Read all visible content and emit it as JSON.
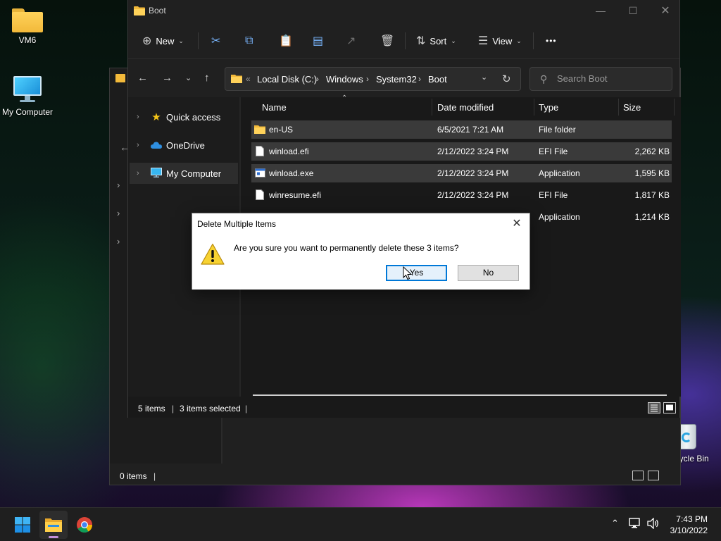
{
  "desktop": {
    "icons": [
      {
        "label": "VM6",
        "icon": "folder-icon"
      },
      {
        "label": "My Computer",
        "icon": "monitor-icon"
      },
      {
        "label": "Recycle Bin",
        "icon": "recycle-bin-icon"
      }
    ]
  },
  "back_window": {
    "status": "0 items"
  },
  "explorer": {
    "title": "Boot",
    "toolbar": {
      "new_label": "New",
      "sort_label": "Sort",
      "view_label": "View",
      "more_label": "•••"
    },
    "address": {
      "overflow": "«",
      "crumbs": [
        "Local Disk (C:)",
        "Windows",
        "System32",
        "Boot"
      ]
    },
    "search": {
      "placeholder": "Search Boot"
    },
    "nav": [
      {
        "label": "Quick access",
        "icon": "star-icon"
      },
      {
        "label": "OneDrive",
        "icon": "cloud-icon"
      },
      {
        "label": "My Computer",
        "icon": "monitor-icon"
      }
    ],
    "columns": [
      "Name",
      "Date modified",
      "Type",
      "Size"
    ],
    "rows": [
      {
        "name": "en-US",
        "date": "6/5/2021 7:21 AM",
        "type": "File folder",
        "size": "",
        "selected": true,
        "icon": "folder-icon"
      },
      {
        "name": "winload.efi",
        "date": "2/12/2022 3:24 PM",
        "type": "EFI File",
        "size": "2,262 KB",
        "selected": true,
        "icon": "file-icon"
      },
      {
        "name": "winload.exe",
        "date": "2/12/2022 3:24 PM",
        "type": "Application",
        "size": "1,595 KB",
        "selected": true,
        "icon": "app-icon"
      },
      {
        "name": "winresume.efi",
        "date": "2/12/2022 3:24 PM",
        "type": "EFI File",
        "size": "1,817 KB",
        "selected": false,
        "icon": "file-icon"
      },
      {
        "name": "",
        "date": "",
        "type": "Application",
        "size": "1,214 KB",
        "selected": false,
        "icon": ""
      }
    ],
    "status": {
      "items": "5 items",
      "selected": "3 items selected"
    }
  },
  "dialog": {
    "title": "Delete Multiple Items",
    "message": "Are you sure you want to permanently delete these 3 items?",
    "yes_label": "Yes",
    "no_label": "No"
  },
  "taskbar": {
    "time": "7:43 PM",
    "date": "3/10/2022"
  },
  "colors": {
    "accent": "#0078d7",
    "selection": "#3a3a3a",
    "window_bg": "#191919",
    "folder_yellow": "#f2b93a"
  }
}
